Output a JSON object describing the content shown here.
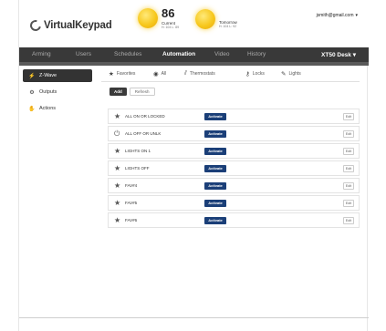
{
  "app": {
    "title": "VirtualKeypad"
  },
  "weather": {
    "current": {
      "temp": "86",
      "label": "Current",
      "detail": "H: 104  L: 89"
    },
    "tomorrow": {
      "label": "Tomorrow",
      "detail": "H: 104  L: 92"
    }
  },
  "user": {
    "email": "jsmith@gmail.com"
  },
  "nav": {
    "items": [
      "Arming",
      "Users",
      "Schedules",
      "Automation",
      "Video",
      "History"
    ],
    "active": "Automation",
    "device": "XT50 Desk"
  },
  "sidebar": {
    "items": [
      {
        "label": "Z-Wave",
        "icon": "zwave-icon",
        "active": true
      },
      {
        "label": "Outputs",
        "icon": "outputs-icon",
        "active": false
      },
      {
        "label": "Actions",
        "icon": "actions-icon",
        "active": false
      }
    ]
  },
  "tabs": [
    "Favorites",
    "All",
    "Thermostats",
    "Locks",
    "Lights"
  ],
  "toolbar": {
    "add_label": "Add",
    "refresh_label": "Refresh"
  },
  "favorites": [
    {
      "name": "ALL ON OR LOCKED",
      "icon": "star-icon",
      "action": "Activate",
      "edit": "Edit"
    },
    {
      "name": "ALL OFF OR UNLK",
      "icon": "power-icon",
      "action": "Activate",
      "edit": "Edit"
    },
    {
      "name": "LIGHTS ON 1",
      "icon": "star-icon",
      "action": "Activate",
      "edit": "Edit"
    },
    {
      "name": "LIGHTS OFF",
      "icon": "star-icon",
      "action": "Activate",
      "edit": "Edit"
    },
    {
      "name": "FAV#4",
      "icon": "star-icon",
      "action": "Activate",
      "edit": "Edit"
    },
    {
      "name": "FAV#5",
      "icon": "star-icon",
      "action": "Activate",
      "edit": "Edit"
    },
    {
      "name": "FAV#6",
      "icon": "star-icon",
      "action": "Activate",
      "edit": "Edit"
    }
  ],
  "colors": {
    "nav_bg": "#393939",
    "activate_bg": "#1b3f78",
    "sun": "#f7c81c"
  }
}
